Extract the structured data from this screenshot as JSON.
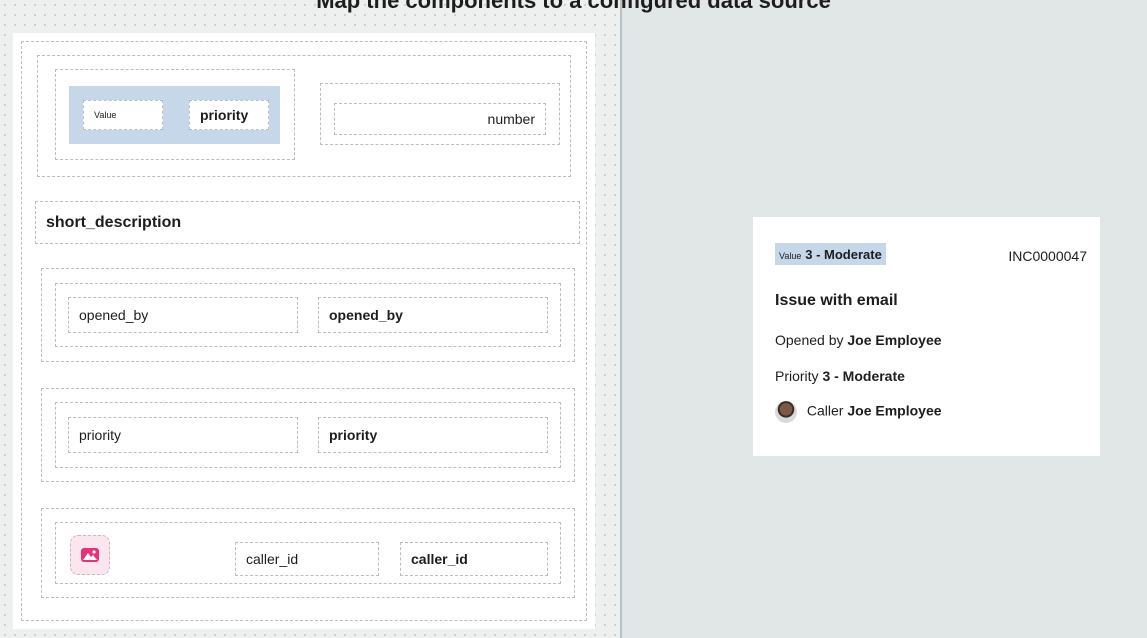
{
  "header": {
    "title": "Map the components to a configured data source"
  },
  "builder": {
    "row1": {
      "value_label": "Value",
      "priority_field": "priority",
      "number_field": "number"
    },
    "short_description_field": "short_description",
    "row_opened": {
      "label": "opened_by",
      "value": "opened_by"
    },
    "row_priority": {
      "label": "priority",
      "value": "priority"
    },
    "row_caller": {
      "image_icon": "image-icon",
      "label": "caller_id",
      "value": "caller_id"
    }
  },
  "preview": {
    "value_label": "Value",
    "priority_value": "3 - Moderate",
    "number": "INC0000047",
    "short_description": "Issue with email",
    "opened_by_label": "Opened by",
    "opened_by_value": "Joe Employee",
    "priority_label": "Priority",
    "priority_value2": "3 - Moderate",
    "caller_label": "Caller",
    "caller_value": "Joe Employee"
  },
  "colors": {
    "selection": "#c6d7ea",
    "canvas_right": "#e1e6e7",
    "image_accent": "#e8317a"
  }
}
